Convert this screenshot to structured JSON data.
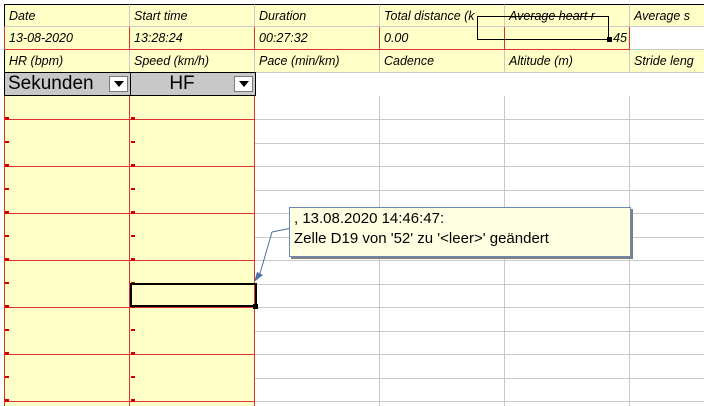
{
  "sheet": {
    "header_row": [
      "Date",
      "Start time",
      "Duration",
      "Total distance (k",
      "Average heart r",
      "Average s"
    ],
    "value_row": [
      "13-08-2020",
      "13:28:24",
      "00:27:32",
      "0.00",
      "45",
      ""
    ],
    "header_row2": [
      "HR (bpm)",
      "Speed (km/h)",
      "Pace (min/km)",
      "Cadence",
      "Altitude (m)",
      "Stride leng"
    ],
    "filters": [
      {
        "value": "Sekunden",
        "icon": "dropdown-arrow-icon"
      },
      {
        "value": "HF",
        "icon": "dropdown-arrow-icon"
      }
    ],
    "colors": {
      "fill": "#ffffc8",
      "grid": "#c9c9c9",
      "red_border": "#e03030",
      "filter_bg": "#c8c8c8",
      "comment_bg": "#ffffe1"
    }
  },
  "comment": {
    "line1": ", 13.08.2020 14:46:47:",
    "line2": "Zelle D19 von '52' zu '<leer>' geändert"
  }
}
